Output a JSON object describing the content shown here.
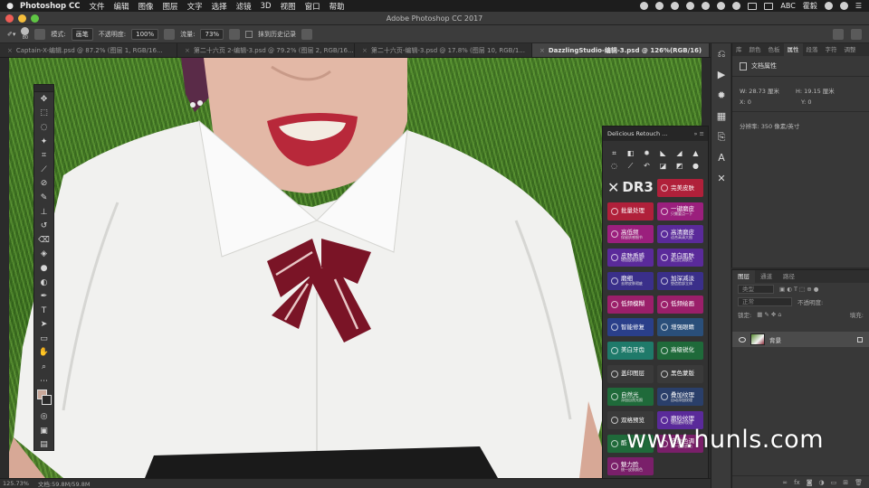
{
  "menubar": {
    "app": "Photoshop CC",
    "items": [
      "文件",
      "编辑",
      "图像",
      "图层",
      "文字",
      "选择",
      "滤镜",
      "3D",
      "视图",
      "窗口",
      "帮助"
    ],
    "right_text": "ABC",
    "user": "霍毅"
  },
  "window": {
    "title": "Adobe Photoshop CC 2017"
  },
  "options": {
    "mode_label": "模式:",
    "mode_value": "画笔",
    "opacity_label": "不透明度:",
    "opacity_value": "100%",
    "flow_label": "流量:",
    "flow_value": "73%",
    "history_label": "抹到历史记录",
    "brush_size": "80"
  },
  "tabs": [
    {
      "label": "Captain-X-编辑.psd @ 87.2% (图层 1, RGB/16...",
      "active": false
    },
    {
      "label": "第二十六页 2-编辑-3.psd @ 79.2% (图层 2, RGB/16...",
      "active": false
    },
    {
      "label": "第二十六页-编辑-3.psd @ 17.8% (图层 10, RGB/1...",
      "active": false
    },
    {
      "label": "DazzlingStudio-编辑-3.psd @ 126%(RGB/16)",
      "active": true
    }
  ],
  "status": {
    "zoom": "125.73%",
    "doc": "文档:59.8M/59.8M"
  },
  "properties": {
    "tabs": [
      "库",
      "颜色",
      "色板",
      "属性",
      "段落",
      "字符",
      "调整"
    ],
    "active_tab": "属性",
    "header": "文档属性",
    "w": "W: 28.73 厘米",
    "h": "H: 19.15 厘米",
    "x": "X: 0",
    "y": "Y: 0",
    "resolution": "分辨率: 350 像素/英寸"
  },
  "layers": {
    "tabs": [
      "图层",
      "通道",
      "路径"
    ],
    "kind": "类型",
    "blend": "正常",
    "opacity_label": "不透明度:",
    "lock_label": "锁定:",
    "fill_label": "填充:",
    "layer_name": "背景"
  },
  "delicious": {
    "title": "Delicious Retouch ...",
    "logo": "DR3",
    "buttons": [
      {
        "label": "完美皮肤",
        "sub": "",
        "color": "#b0203a"
      },
      {
        "label": "批量处理",
        "sub": "",
        "color": "#b0203a"
      },
      {
        "label": "一键磨皮",
        "sub": "只需要点一下",
        "color": "#9b1f7d"
      },
      {
        "label": "高低频",
        "sub": "保留质感细节",
        "color": "#9b1f7d"
      },
      {
        "label": "高清磨皮",
        "sub": "适合高清大图",
        "color": "#5a2a9a"
      },
      {
        "label": "皮肤质感",
        "sub": "增加皮肤质感",
        "color": "#5a2a9a"
      },
      {
        "label": "美白肌肤",
        "sub": "美白红润肤色",
        "color": "#5a2a9a"
      },
      {
        "label": "磨细",
        "sub": "去除皮肤瑕疵",
        "color": "#3a2f8a"
      },
      {
        "label": "加深减淡",
        "sub": "塑造脸部立体",
        "color": "#3a2f8a"
      },
      {
        "label": "低频模糊",
        "sub": "",
        "color": "#9b1f6a"
      },
      {
        "label": "低频绘画",
        "sub": "",
        "color": "#9b1f6a"
      },
      {
        "label": "智能修复",
        "sub": "",
        "color": "#2a3f8a"
      },
      {
        "label": "增强眼睛",
        "sub": "",
        "color": "#2a4f7a"
      },
      {
        "label": "美白牙齿",
        "sub": "",
        "color": "#1f7a6a"
      },
      {
        "label": "高级锐化",
        "sub": "",
        "color": "#1f6a3a"
      },
      {
        "label": "盖印图层",
        "sub": "",
        "color": "#3a3a3a"
      },
      {
        "label": "黑色蒙版",
        "sub": "",
        "color": "#3a3a3a"
      },
      {
        "label": "自然光",
        "sub": "添加自然光照",
        "color": "#1f6a3a"
      },
      {
        "label": "叠加纹理",
        "sub": "自动添加纹理",
        "color": "#2a3f6a"
      },
      {
        "label": "双格预览",
        "sub": "",
        "color": "#3a3a3a"
      },
      {
        "label": "磨砂纹理",
        "sub": "增加磨砂纹理",
        "color": "#5a2a9a"
      },
      {
        "label": "酷",
        "sub": "",
        "color": "#1f6a3a"
      },
      {
        "label": "皮肤色调",
        "sub": "统一皮肤颜色",
        "color": "#7a1f6a"
      },
      {
        "label": "魅力脸",
        "sub": "统一皮肤颜色",
        "color": "#7a1f6a"
      }
    ]
  },
  "watermark": "www.hunls.com"
}
